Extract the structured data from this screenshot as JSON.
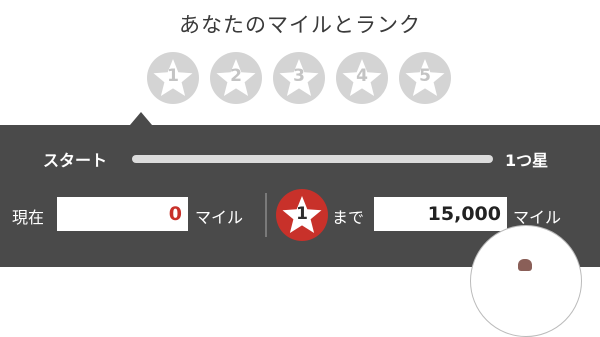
{
  "header": {
    "title": "あなたのマイルとランク"
  },
  "ranks": [
    {
      "label": "1"
    },
    {
      "label": "2"
    },
    {
      "label": "3"
    },
    {
      "label": "4"
    },
    {
      "label": "5"
    }
  ],
  "progress": {
    "start_label": "スタート",
    "end_label": "1つ星",
    "fraction": 0
  },
  "miles": {
    "current_label": "現在",
    "current_value": "0",
    "unit": "マイル",
    "next_rank": "1",
    "until_label": "まで",
    "target_value": "15,000",
    "target_unit": "マイル"
  },
  "colors": {
    "panel_bg": "#4a4a4a",
    "accent_red": "#c8312a",
    "inactive_star_bg": "#d4d4d4"
  },
  "icons": {
    "rank": "star-icon",
    "fab": "menu-icon"
  }
}
